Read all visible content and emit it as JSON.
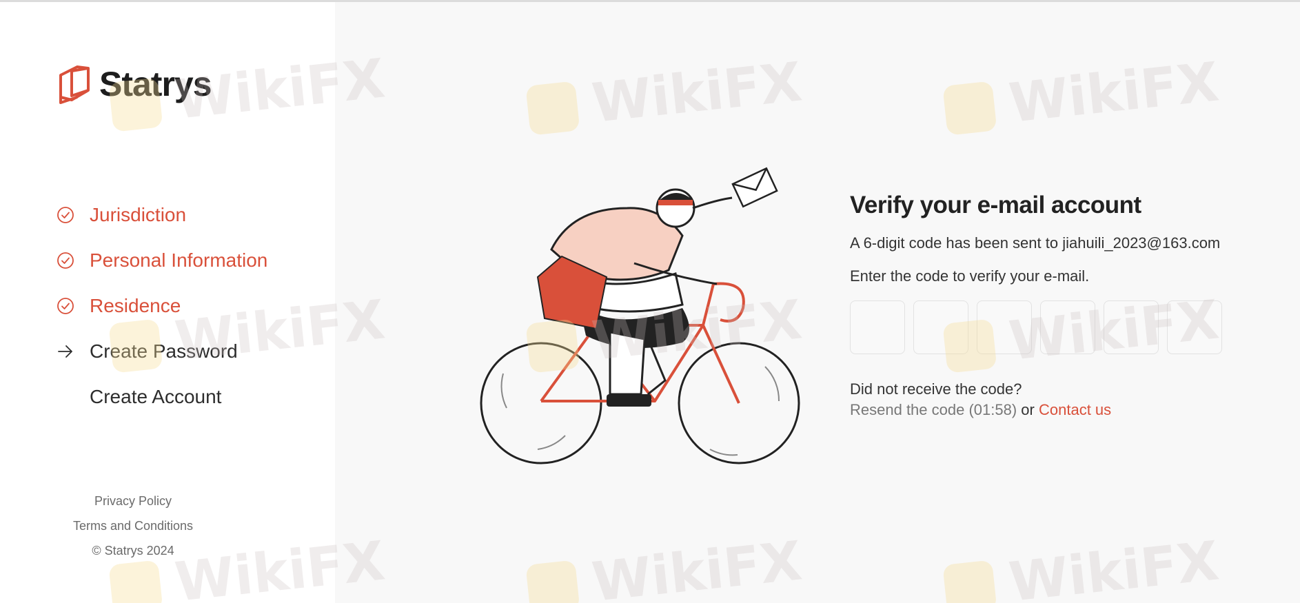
{
  "brand": {
    "name": "Statrys",
    "accent": "#d9503a"
  },
  "steps": [
    {
      "label": "Jurisdiction",
      "state": "done",
      "icon": "check-circle-icon"
    },
    {
      "label": "Personal Information",
      "state": "done",
      "icon": "check-circle-icon"
    },
    {
      "label": "Residence",
      "state": "done",
      "icon": "check-circle-icon"
    },
    {
      "label": "Create Password",
      "state": "current",
      "icon": "arrow-right-icon"
    },
    {
      "label": "Create Account",
      "state": "todo",
      "icon": ""
    }
  ],
  "footer": {
    "privacy": "Privacy Policy",
    "terms": "Terms and Conditions",
    "copyright": "© Statrys 2024"
  },
  "verify": {
    "title": "Verify your e-mail account",
    "sent_text": "A 6-digit code has been sent to jiahuili_2023@163.com",
    "instruction": "Enter the code to verify your e-mail.",
    "code_digits": [
      "",
      "",
      "",
      "",
      "",
      ""
    ],
    "not_received": "Did not receive the code?",
    "resend": "Resend the code (01:58)",
    "or": "or",
    "contact": "Contact us"
  },
  "watermark": "WikiFX"
}
